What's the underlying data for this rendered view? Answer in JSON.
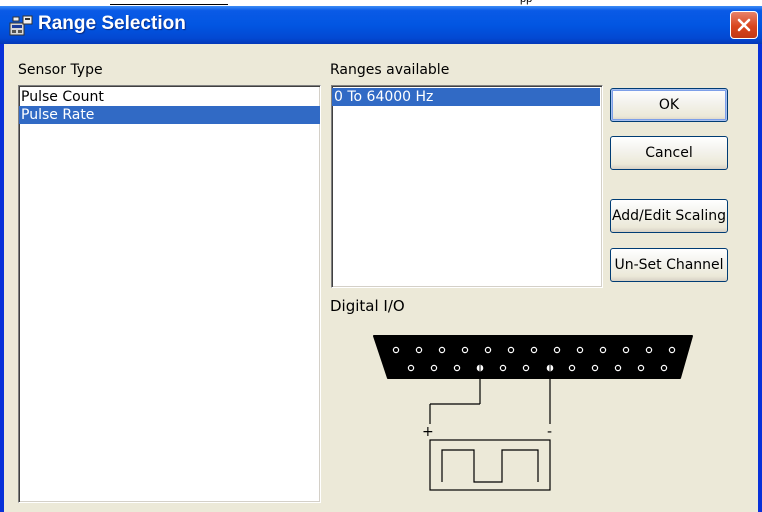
{
  "window": {
    "title": "Range Selection"
  },
  "top_strip": {
    "text": "pp"
  },
  "sensor_type": {
    "label": "Sensor Type",
    "items": [
      {
        "label": "Pulse Count",
        "selected": false
      },
      {
        "label": "Pulse Rate",
        "selected": true
      }
    ]
  },
  "ranges": {
    "label": "Ranges available",
    "items": [
      {
        "label": "0 To 64000 Hz",
        "selected": true
      }
    ]
  },
  "buttons": {
    "ok": "OK",
    "cancel": "Cancel",
    "add_edit_scaling": "Add/Edit Scaling",
    "unset_channel": "Un-Set Channel"
  },
  "digital_io": {
    "label": "Digital I/O",
    "plus": "+",
    "minus": "-"
  },
  "colors": {
    "titlebar": "#0256e2",
    "selection": "#316ac5",
    "dialog_bg": "#ece9d8",
    "close_button": "#d9461e"
  }
}
